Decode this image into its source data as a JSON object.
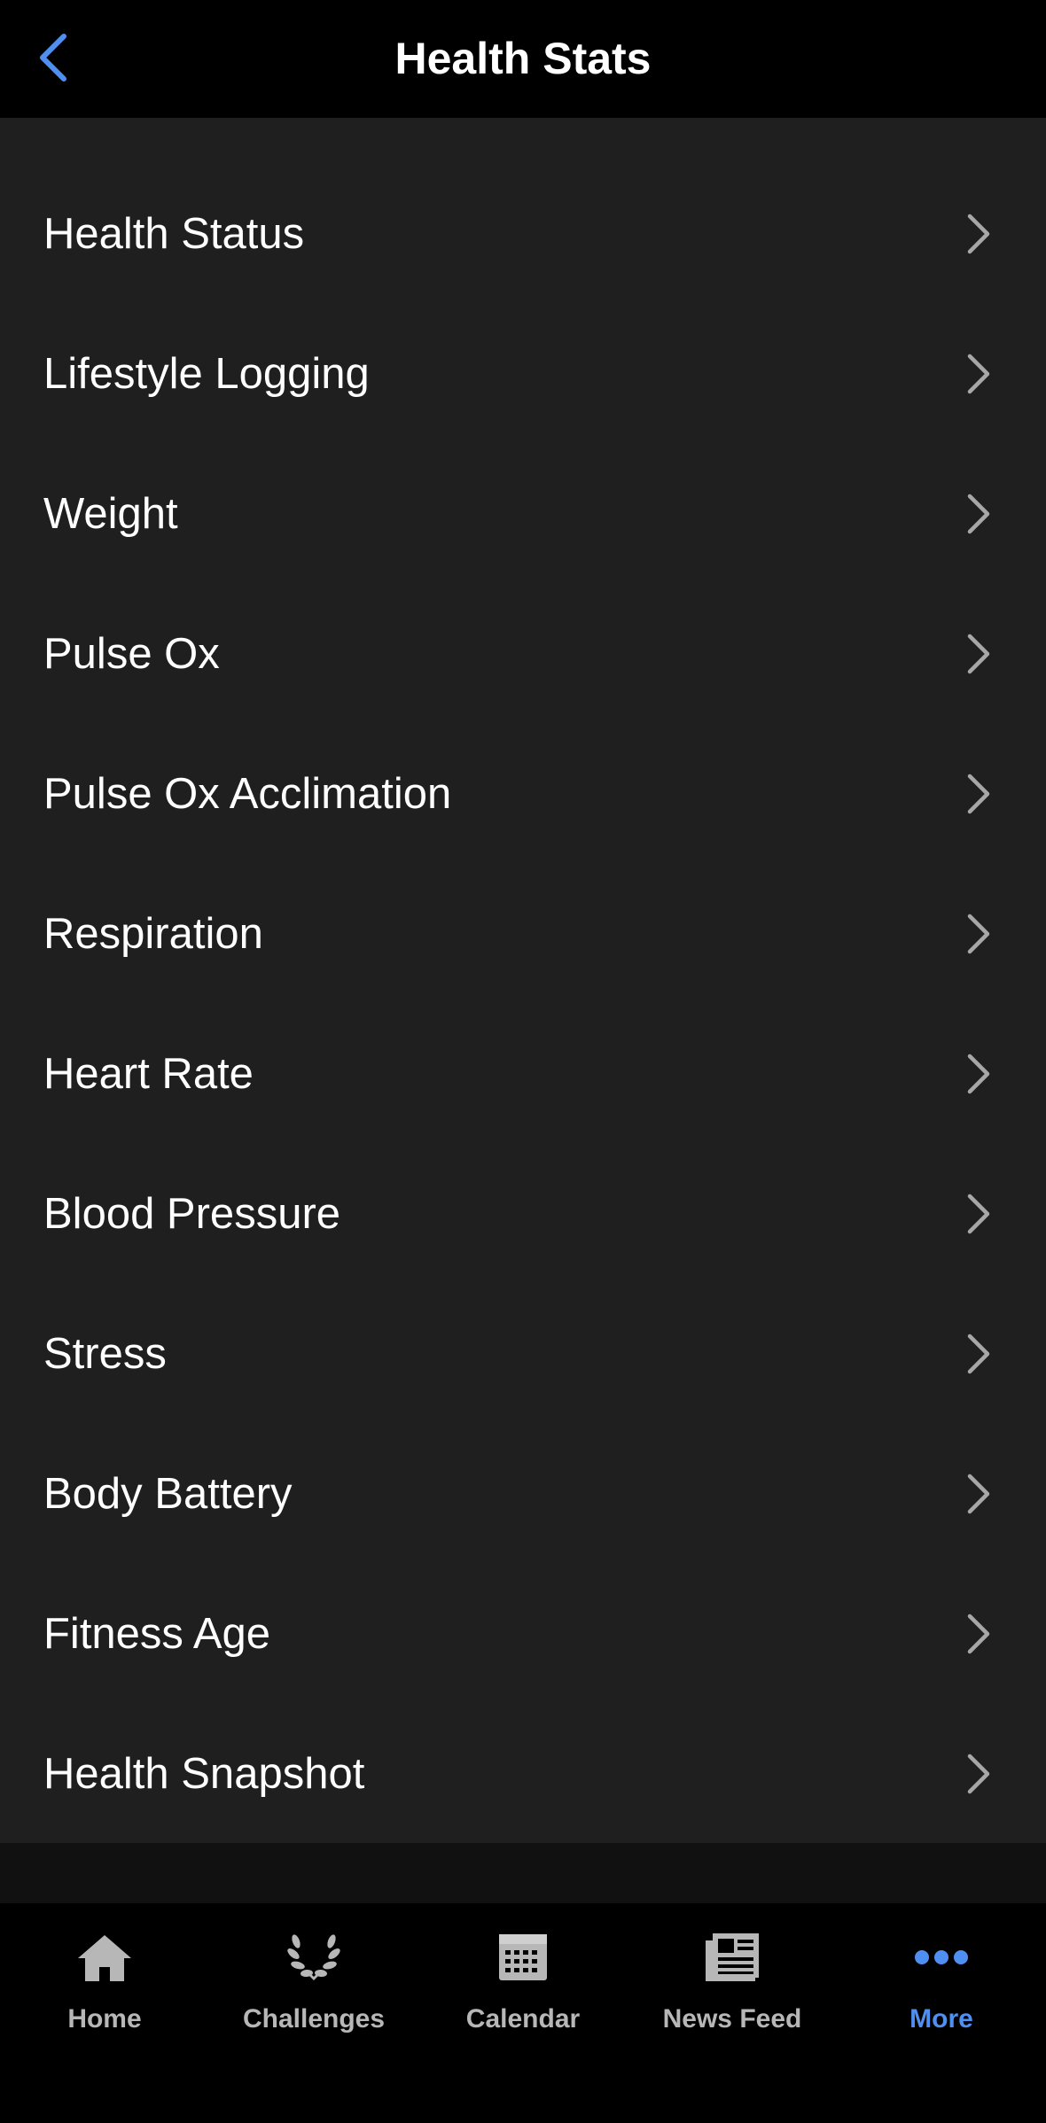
{
  "colors": {
    "accent": "#4f8ff1",
    "header_bg": "#000000",
    "list_bg": "#1f1f20",
    "page_bg": "#111112",
    "tab_inactive": "#b7b7b8",
    "chevron": "#a7a7a8"
  },
  "header": {
    "title": "Health Stats",
    "back_icon": "chevron-left-icon"
  },
  "list": {
    "items": [
      {
        "label": "Health Status"
      },
      {
        "label": "Lifestyle Logging"
      },
      {
        "label": "Weight"
      },
      {
        "label": "Pulse Ox"
      },
      {
        "label": "Pulse Ox Acclimation"
      },
      {
        "label": "Respiration"
      },
      {
        "label": "Heart Rate"
      },
      {
        "label": "Blood Pressure"
      },
      {
        "label": "Stress"
      },
      {
        "label": "Body Battery"
      },
      {
        "label": "Fitness Age"
      },
      {
        "label": "Health Snapshot"
      }
    ]
  },
  "tabbar": {
    "tabs": [
      {
        "label": "Home",
        "icon": "home-icon",
        "active": false
      },
      {
        "label": "Challenges",
        "icon": "laurel-icon",
        "active": false
      },
      {
        "label": "Calendar",
        "icon": "calendar-icon",
        "active": false
      },
      {
        "label": "News Feed",
        "icon": "newspaper-icon",
        "active": false
      },
      {
        "label": "More",
        "icon": "more-dots-icon",
        "active": true
      }
    ]
  }
}
